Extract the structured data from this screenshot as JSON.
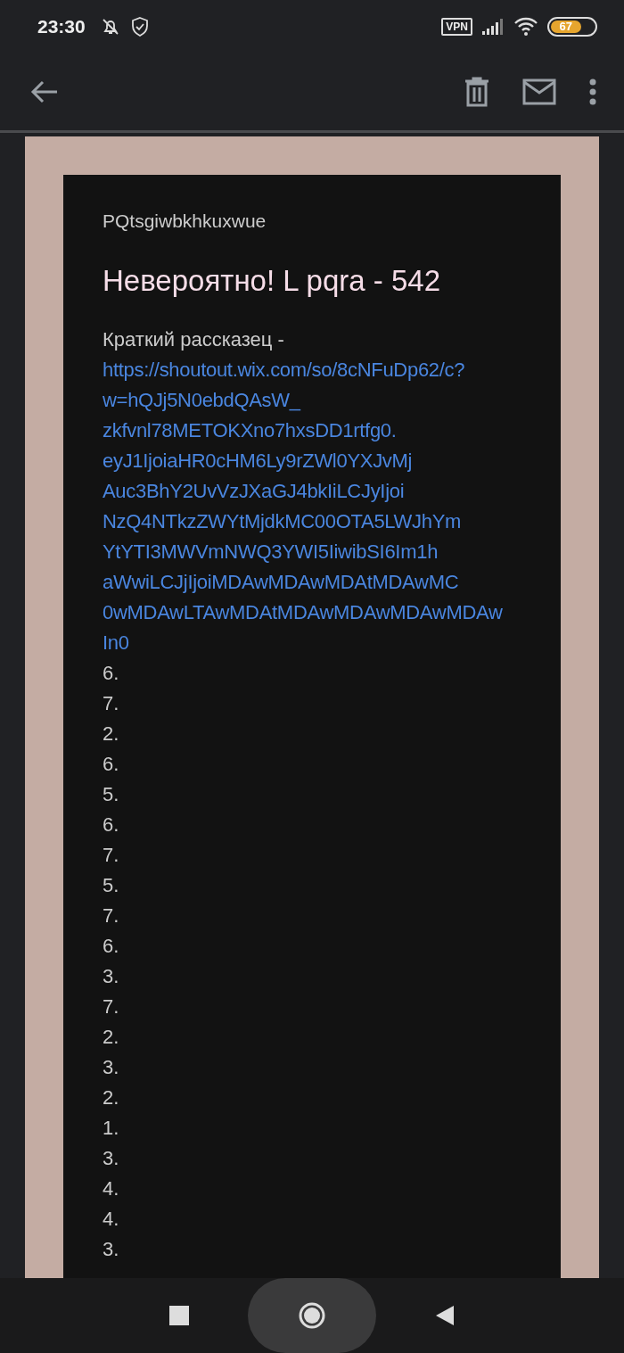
{
  "status_bar": {
    "time": "23:30",
    "vpn": "VPN",
    "battery": "67"
  },
  "email": {
    "sender": "PQtsgiwbkhkuxwue",
    "subject": "Невероятно! L pqra - 542",
    "intro": "Краткий рассказец -",
    "link_lines": [
      "https://shoutout.wix.com/so/8cNFuDp62/c?",
      "w=hQJj5N0ebdQAsW_",
      "zkfvnl78METOKXno7hxsDD1rtfg0.",
      "eyJ1IjoiaHR0cHM6Ly9rZWl0YXJvMj",
      "Auc3BhY2UvVzJXaGJ4bkIiLCJyIjoi",
      "NzQ4NTkzZWYtMjdkMC00OTA5LWJhYm",
      "YtYTI3MWVmNWQ3YWI5IiwibSI6Im1h",
      "aWwiLCJjIjoiMDAwMDAwMDAtMDAwMC",
      "0wMDAwLTAwMDAtMDAwMDAwMDAwMDAw",
      "In0"
    ],
    "lines": [
      "6.",
      "7.",
      "2.",
      "6.",
      "5.",
      "6.",
      "7.",
      "5.",
      "7.",
      "6.",
      "3.",
      "7.",
      "2.",
      "3.",
      "2.",
      "1.",
      "3.",
      "4.",
      "4.",
      "3."
    ]
  }
}
